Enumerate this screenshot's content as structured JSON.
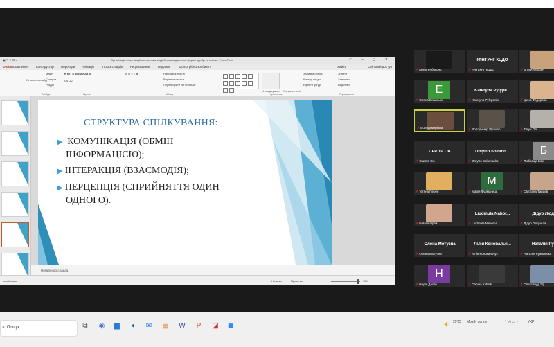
{
  "ppt": {
    "title": "Організація комунікації наставника зі здобувачем дуальної форми здобуття освіти - PowerPoint",
    "tabs": [
      "Файл",
      "Вставлення",
      "Конструктор",
      "Переходи",
      "Анімація",
      "Показ слайдів",
      "Рецензування",
      "Подання",
      "Що потрібно зробити?"
    ],
    "user": "Увійти",
    "share": "Спільний доступ",
    "ribbon_groups": [
      "Слайди",
      "Шрифт",
      "Абзац",
      "Креслення",
      "Редагування"
    ],
    "ribbon_buttons": {
      "new_slide": "Створити слайд",
      "layout": "Макет",
      "reset": "Скинути",
      "section": "Розділ",
      "text_direction": "Напрямок тексту",
      "align_text": "Вирівняти текст",
      "smartart": "Перетворити на SmartArt",
      "arrange": "Упорядкувати",
      "quick_styles": "Експрес-стилі",
      "fill": "Заливка фігури",
      "outline": "Контур фігури",
      "effects": "Ефекти фігур",
      "find": "Знайти",
      "replace": "Замінити",
      "select": "Виділити"
    },
    "slide": {
      "title": "СТРУКТУРА СПІЛКУВАННЯ:",
      "bullets": [
        [
          "КОМУНІКАЦІЯ (ОБМІН",
          "ІНФОРМАЦІЄЮ);"
        ],
        [
          "ІНТЕРАКЦІЯ (ВЗАЄМОДІЯ);"
        ],
        [
          "ПЕРЦЕПЦІЯ (СПРИЙНЯТТЯ ОДИН",
          "ОДНОГО)."
        ]
      ]
    },
    "notes_placeholder": "Нотатки до слайда",
    "status": {
      "slide": "українська",
      "notes": "Нотатки",
      "comments": "Примітки",
      "zoom": "95%"
    }
  },
  "participants": [
    {
      "display": "",
      "label": "Ірина Рябоконь",
      "kind": "photo",
      "color": "#1a1a1a"
    },
    {
      "display": "ІФНТУНГ КЦДО",
      "label": "ІФНТУНГ КЦДО",
      "kind": "name",
      "color": "#2a2a2a"
    },
    {
      "display": "",
      "label": "Віта Кулебрен",
      "kind": "photo",
      "color": "#c8a27a"
    },
    {
      "display": "E",
      "label": "Олена Блажсько",
      "kind": "letter",
      "color": "#3a9a3a"
    },
    {
      "display": "Kateryna Pylype...",
      "label": "Kateryna Pylypenko",
      "kind": "name",
      "color": "#2a2a2a"
    },
    {
      "display": "",
      "label": "Ірина Федорова",
      "kind": "photo",
      "color": "#d9b48f"
    },
    {
      "display": "",
      "label": "Володимирівна",
      "kind": "photo",
      "color": "#6b4e3d"
    },
    {
      "display": "",
      "label": "Володимир Пушкар",
      "kind": "photo",
      "color": "#5a5248"
    },
    {
      "display": "",
      "label": "Тягун Ол",
      "kind": "photo",
      "color": "#b5b0aa"
    },
    {
      "display": "Свитка ОА",
      "label": "Свитка ОА",
      "kind": "name",
      "color": "#2a2a2a"
    },
    {
      "display": "Dmytro Solomo...",
      "label": "Dmytro Solomonko",
      "kind": "name",
      "color": "#2a2a2a"
    },
    {
      "display": "Б",
      "label": "Любомир Бор",
      "kind": "letter",
      "color": "#8a8a8a"
    },
    {
      "display": "",
      "label": "тетяна Переп",
      "kind": "photo",
      "color": "#e0b060"
    },
    {
      "display": "M",
      "label": "Марія Фурманець",
      "kind": "letter",
      "color": "#2e6b3e"
    },
    {
      "display": "",
      "label": "Світлана Тараев",
      "kind": "photo",
      "color": "#c7a58a"
    },
    {
      "display": "",
      "label": "Natalia Фрай",
      "kind": "photo",
      "color": "#d2a68c"
    },
    {
      "display": "Liudmula Nahor...",
      "label": "Liudmula Nahorna",
      "kind": "name",
      "color": "#2a2a2a"
    },
    {
      "display": "Дідур Люди",
      "label": "Дідур Людмила",
      "kind": "name",
      "color": "#2a2a2a"
    },
    {
      "display": "Олена Мотузна",
      "label": "Олена Мотузна",
      "kind": "name",
      "color": "#2a2a2a"
    },
    {
      "display": "Лілія Коновальч...",
      "label": "Лілія Коновальчук",
      "kind": "name",
      "color": "#2a2a2a"
    },
    {
      "display": "Наталія Руж",
      "label": "Наталія Ружанська",
      "kind": "name",
      "color": "#2a2a2a"
    },
    {
      "display": "H",
      "label": "Надія Далек",
      "kind": "letter",
      "color": "#7a3aa0"
    },
    {
      "display": "",
      "label": "Сабіна Klibalk",
      "kind": "photo",
      "color": "#3a3a3a"
    },
    {
      "display": "",
      "label": "Олександр Пр",
      "kind": "photo",
      "color": "#7c8ea8"
    }
  ],
  "taskbar": {
    "search": "Пошук",
    "weather": "29°C",
    "weather_text": "Mostly sunny",
    "lang": "УКР"
  }
}
